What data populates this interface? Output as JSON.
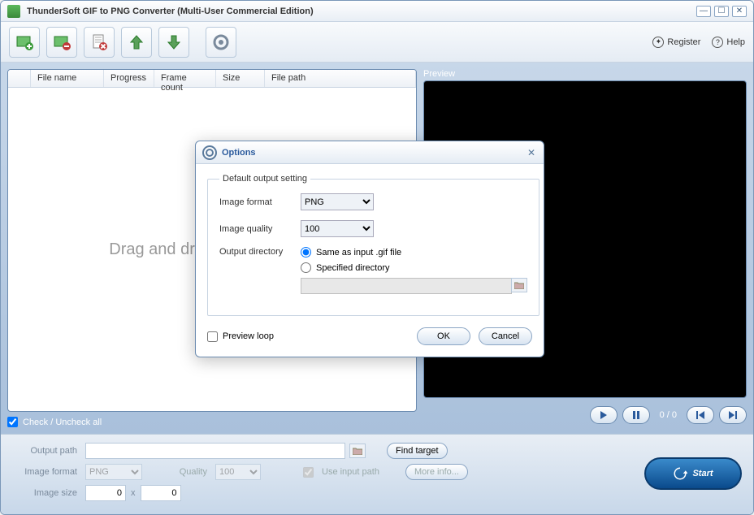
{
  "titlebar": {
    "title": "ThunderSoft GIF to PNG Converter (Multi-User Commercial Edition)"
  },
  "toolbar": {
    "register": "Register",
    "help": "Help"
  },
  "list": {
    "cols": {
      "filename": "File name",
      "progress": "Progress",
      "framecount": "Frame count",
      "size": "Size",
      "filepath": "File path"
    },
    "placeholder": "Drag and drop GIF files here",
    "checkall": "Check / Uncheck all"
  },
  "preview": {
    "label": "Preview",
    "counter": "0 / 0"
  },
  "bottom": {
    "output_path_label": "Output path",
    "output_path": "",
    "find_target": "Find target",
    "image_format_label": "Image format",
    "image_format": "PNG",
    "quality_label": "Quality",
    "quality": "100",
    "use_input_path": "Use input path",
    "more_info": "More info...",
    "image_size_label": "Image size",
    "image_w": "0",
    "image_h": "0",
    "start": "Start"
  },
  "dialog": {
    "title": "Options",
    "legend": "Default output setting",
    "image_format_label": "Image format",
    "image_format": "PNG",
    "image_quality_label": "Image quality",
    "image_quality": "100",
    "output_dir_label": "Output directory",
    "radio_same": "Same as input .gif file",
    "radio_spec": "Specified directory",
    "spec_path": "",
    "preview_loop": "Preview loop",
    "ok": "OK",
    "cancel": "Cancel"
  }
}
